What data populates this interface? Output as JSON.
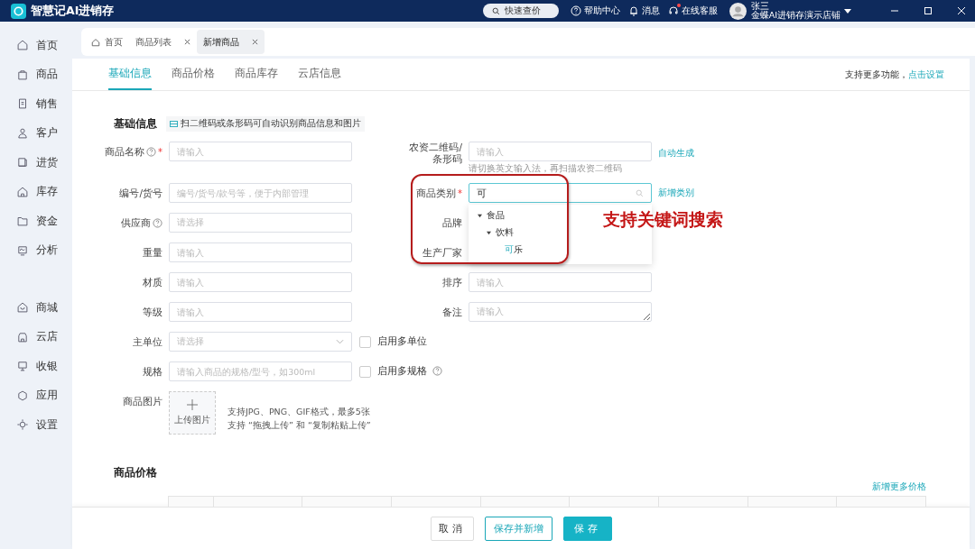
{
  "app": {
    "title": "智慧记AI进销存"
  },
  "header": {
    "search": {
      "label": "快速查价"
    },
    "links": [
      {
        "kind": "help",
        "label": "帮助中心",
        "badge": false
      },
      {
        "kind": "bell",
        "label": "消息",
        "badge": false
      },
      {
        "kind": "service",
        "label": "在线客服",
        "badge": true
      }
    ],
    "user": {
      "name": "张三",
      "shop": "金蝶AI进销存演示店铺"
    }
  },
  "sidebar": {
    "sections": [
      [
        {
          "label": "首页"
        },
        {
          "label": "商品"
        },
        {
          "label": "销售"
        },
        {
          "label": "客户"
        },
        {
          "label": "进货"
        },
        {
          "label": "库存"
        },
        {
          "label": "资金"
        },
        {
          "label": "分析"
        }
      ],
      [
        {
          "label": "商城"
        },
        {
          "label": "云店"
        },
        {
          "label": "收银"
        },
        {
          "label": "应用"
        },
        {
          "label": "设置"
        }
      ]
    ]
  },
  "page_tabs": [
    {
      "label": "首页",
      "home": true,
      "closable": false,
      "selected": false
    },
    {
      "label": "商品列表",
      "home": false,
      "closable": true,
      "selected": false
    },
    {
      "label": "新增商品",
      "home": false,
      "closable": true,
      "selected": true
    }
  ],
  "sub_tabs": [
    {
      "label": "基础信息",
      "selected": true
    },
    {
      "label": "商品价格",
      "selected": false
    },
    {
      "label": "商品库存",
      "selected": false
    },
    {
      "label": "云店信息",
      "selected": false
    }
  ],
  "settings_hint": {
    "text": "支持更多功能，",
    "link": "点击设置"
  },
  "basic": {
    "title": "基础信息",
    "note": "扫二维码或条形码可自动识别商品信息和图片",
    "rows": [
      {
        "left": {
          "kind": "input",
          "label": "商品名称",
          "help": true,
          "mark": "*",
          "placeholder": "请输入"
        },
        "right": {
          "kind": "input",
          "label": "农资二维码/条形码",
          "placeholder": "请输入",
          "link": "自动生成",
          "hint": "请切换英文输入法，再扫描农资二维码"
        }
      },
      {
        "left": {
          "kind": "input",
          "label": "编号/货号",
          "placeholder": "编号/货号/款号等，便于内部管理"
        },
        "right": {
          "kind": "search",
          "label": "商品类别",
          "mark": "*",
          "value": "可",
          "link": "新增类别",
          "dropdown": [
            {
              "label": "食品",
              "expanded": true,
              "children": [
                {
                  "label": "饮料",
                  "expanded": true,
                  "children": [
                    {
                      "match": "可",
                      "rest": "乐"
                    }
                  ]
                }
              ]
            }
          ]
        }
      },
      {
        "left": {
          "kind": "select",
          "label": "供应商",
          "help": true,
          "placeholder": "请选择"
        },
        "right": {
          "kind": "covered",
          "label": "品牌"
        }
      },
      {
        "left": {
          "kind": "input",
          "label": "重量",
          "placeholder": "请输入"
        },
        "right": {
          "kind": "covered",
          "label": "生产厂家"
        }
      },
      {
        "left": {
          "kind": "input",
          "label": "材质",
          "placeholder": "请输入"
        },
        "right": {
          "kind": "input",
          "label": "排序",
          "placeholder": "请输入"
        }
      },
      {
        "left": {
          "kind": "input",
          "label": "等级",
          "placeholder": "请输入"
        },
        "right": {
          "kind": "textarea",
          "label": "备注",
          "placeholder": "请输入"
        }
      },
      {
        "left": {
          "kind": "select",
          "label": "主单位",
          "placeholder": "请选择"
        },
        "right": {
          "kind": "checkbox",
          "label": "启用多单位",
          "checked": false
        }
      },
      {
        "left": {
          "kind": "input",
          "label": "规格",
          "placeholder": "请输入商品的规格/型号，如300ml"
        },
        "right": {
          "kind": "checkbox",
          "label": "启用多规格",
          "help": true,
          "checked": false
        }
      },
      {
        "left": {
          "kind": "upload",
          "label": "商品图片",
          "button": "上传图片",
          "notes": [
            "支持JPG、PNG、GIF格式，最多5张",
            "支持 “拖拽上传” 和 “复制粘贴上传”"
          ]
        }
      }
    ]
  },
  "annotation": {
    "text": "支持关键词搜索"
  },
  "price": {
    "title": "商品价格",
    "link": "新增更多价格"
  },
  "footer": {
    "buttons": [
      {
        "kind": "plain",
        "label": "取消"
      },
      {
        "kind": "outline",
        "label": "保存并新增"
      },
      {
        "kind": "primary",
        "label": "保存"
      }
    ]
  }
}
